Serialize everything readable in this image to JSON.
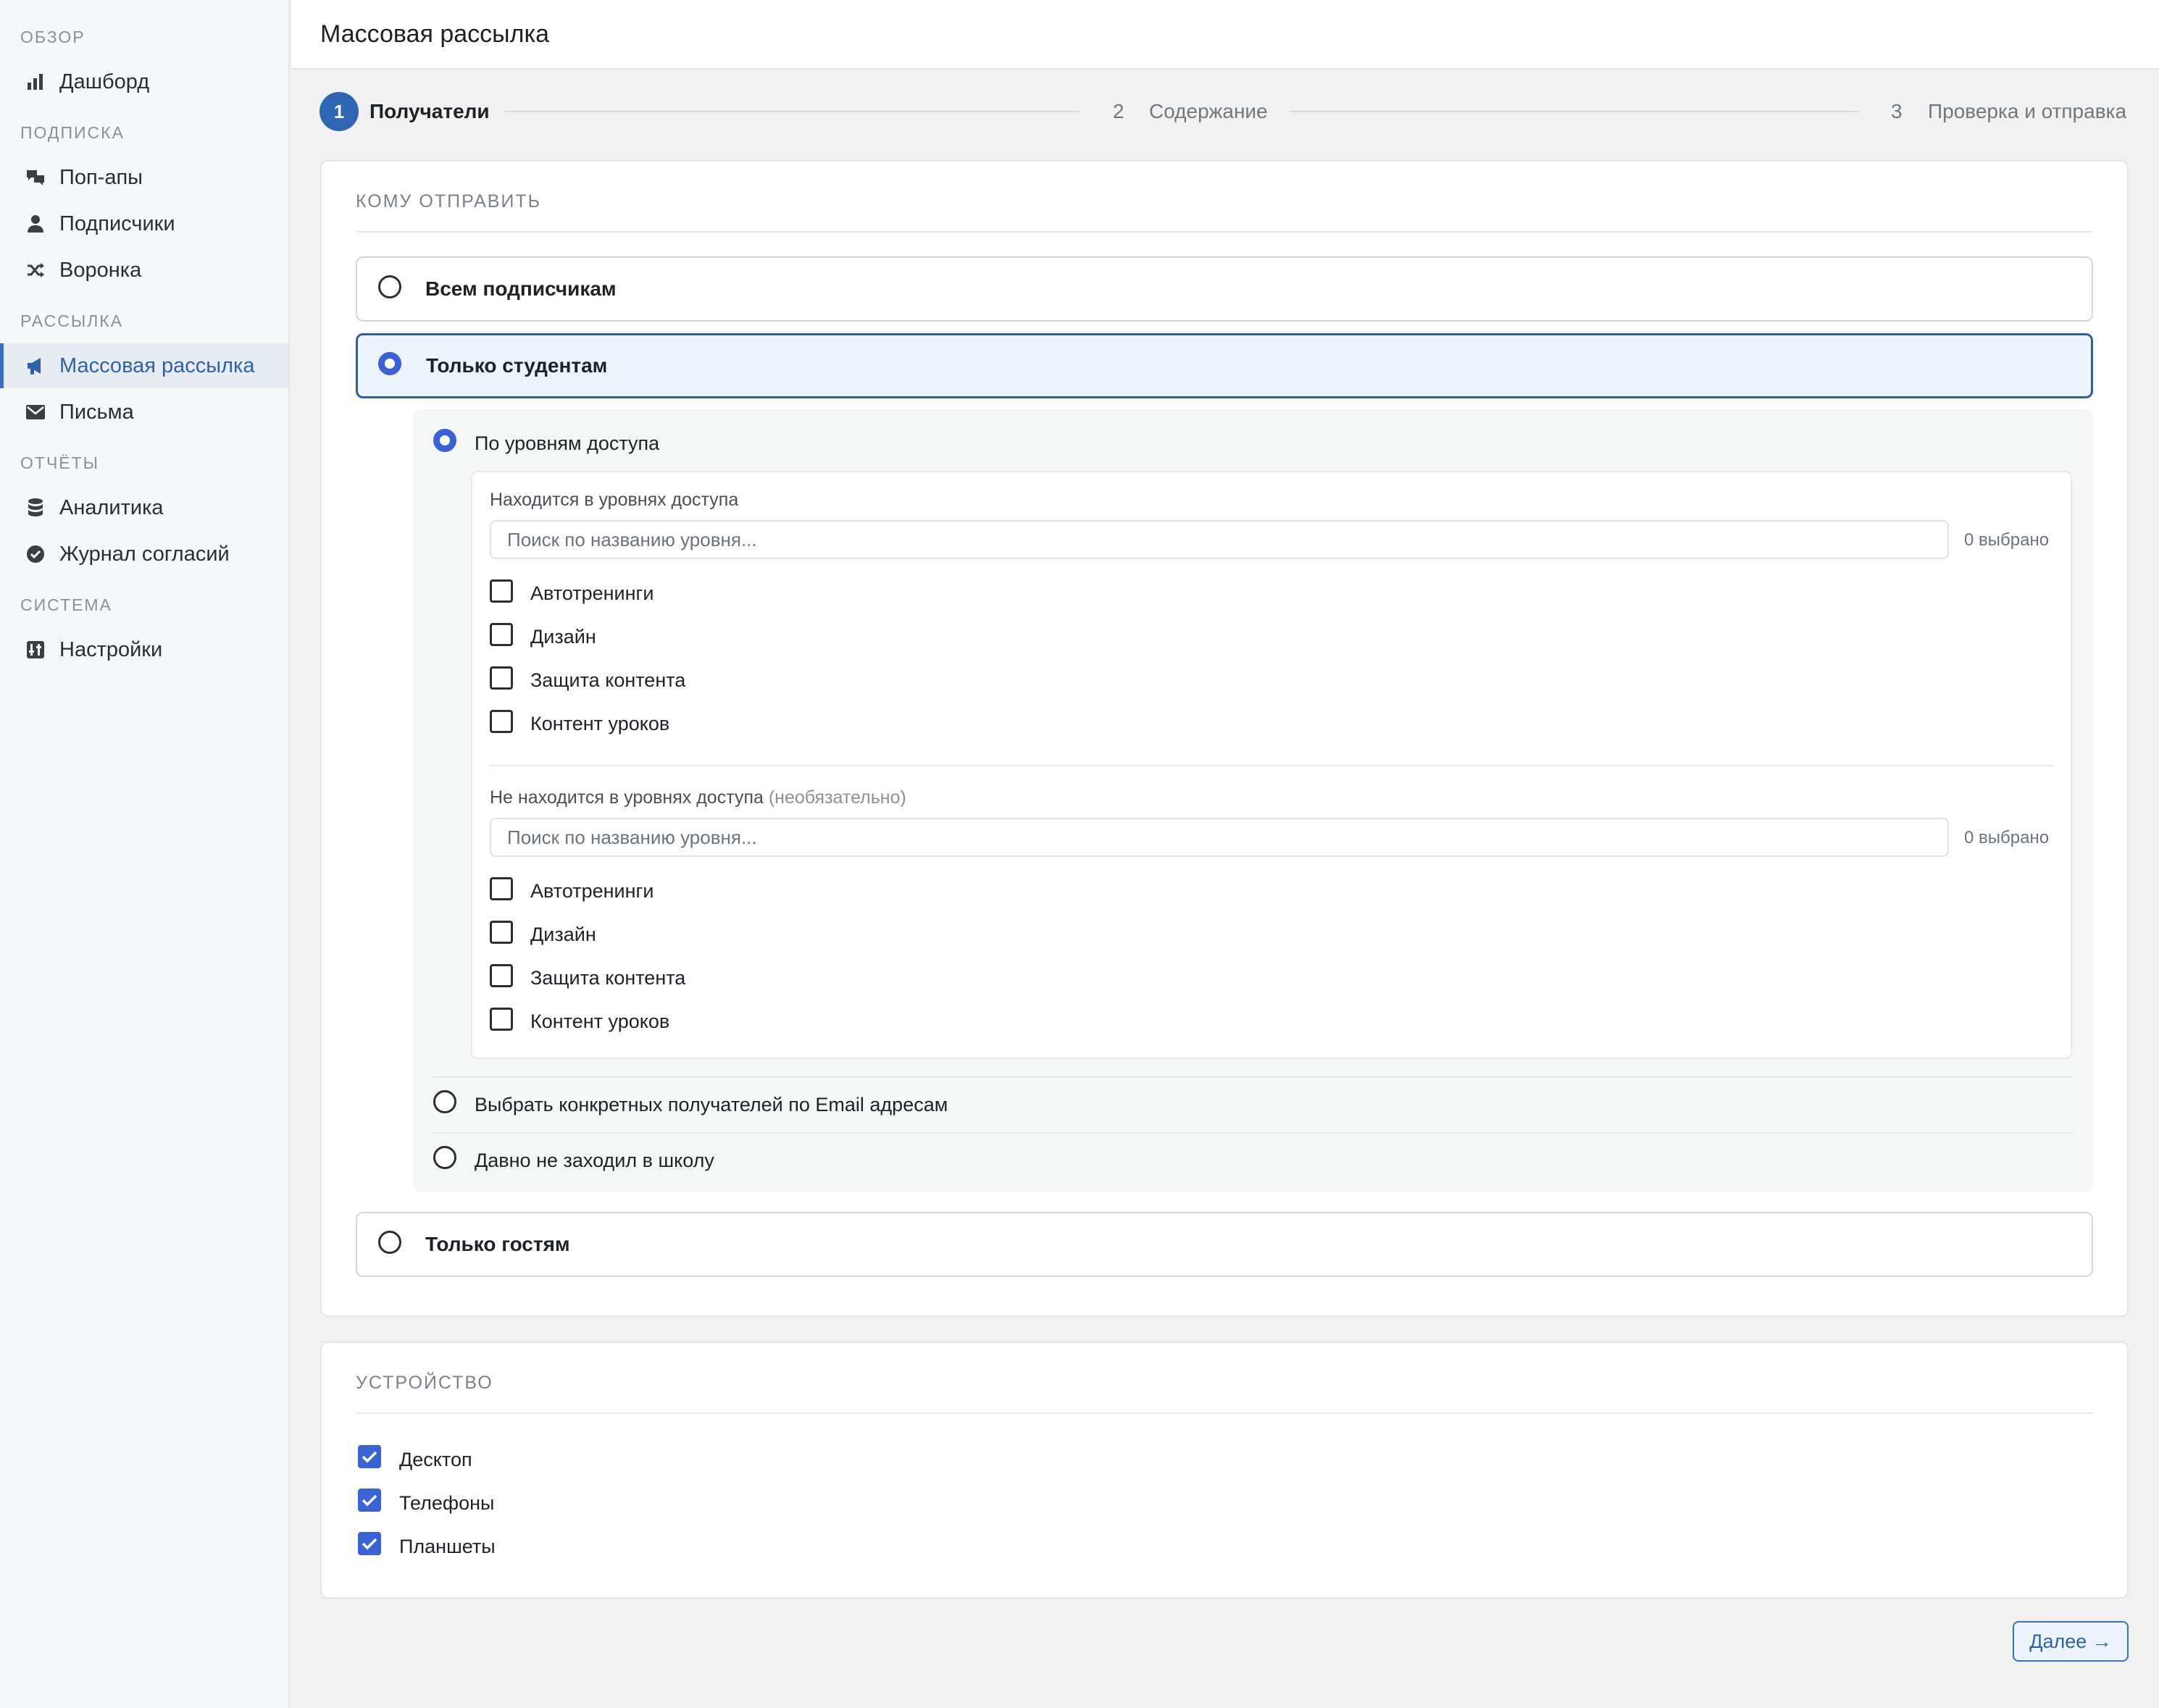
{
  "sidebar": {
    "sections": [
      {
        "title": "ОБЗОР",
        "items": [
          {
            "label": "Дашборд",
            "icon": "bar-chart-icon"
          }
        ]
      },
      {
        "title": "ПОДПИСКА",
        "items": [
          {
            "label": "Поп-апы",
            "icon": "chat-bubbles-icon"
          },
          {
            "label": "Подписчики",
            "icon": "user-icon"
          },
          {
            "label": "Воронка",
            "icon": "shuffle-icon"
          }
        ]
      },
      {
        "title": "РАССЫЛКА",
        "items": [
          {
            "label": "Массовая рассылка",
            "icon": "megaphone-icon",
            "active": true
          },
          {
            "label": "Письма",
            "icon": "envelope-icon"
          }
        ]
      },
      {
        "title": "ОТЧЁТЫ",
        "items": [
          {
            "label": "Аналитика",
            "icon": "database-icon"
          },
          {
            "label": "Журнал согласий",
            "icon": "check-circle-icon"
          }
        ]
      },
      {
        "title": "СИСТЕМА",
        "items": [
          {
            "label": "Настройки",
            "icon": "settings-icon"
          }
        ]
      }
    ]
  },
  "header": {
    "title": "Массовая рассылка"
  },
  "stepper": {
    "steps": [
      {
        "num": "1",
        "label": "Получатели",
        "active": true
      },
      {
        "num": "2",
        "label": "Содержание",
        "active": false
      },
      {
        "num": "3",
        "label": "Проверка и отправка",
        "active": false
      }
    ]
  },
  "recipients": {
    "title": "КОМУ ОТПРАВИТЬ",
    "options": {
      "all": "Всем подписчикам",
      "students": "Только студентам",
      "guests": "Только гостям"
    },
    "selected": "students",
    "student_modes": {
      "by_level": "По уровням доступа",
      "by_email": "Выбрать конкретных получателей по Email адресам",
      "inactive": "Давно не заходил в школу"
    },
    "include": {
      "label": "Находится в уровнях доступа",
      "placeholder": "Поиск по названию уровня...",
      "count": "0 выбрано",
      "levels": [
        "Автотренинги",
        "Дизайн",
        "Защита контента",
        "Контент уроков"
      ]
    },
    "exclude": {
      "label": "Не находится в уровнях доступа",
      "optional": "(необязательно)",
      "placeholder": "Поиск по названию уровня...",
      "count": "0 выбрано",
      "levels": [
        "Автотренинги",
        "Дизайн",
        "Защита контента",
        "Контент уроков"
      ]
    }
  },
  "device": {
    "title": "УСТРОЙСТВО",
    "items": [
      {
        "label": "Десктоп",
        "checked": true
      },
      {
        "label": "Телефоны",
        "checked": true
      },
      {
        "label": "Планшеты",
        "checked": true
      }
    ]
  },
  "footer": {
    "next_label": "Далее →"
  },
  "colors": {
    "accent": "#3a62d6",
    "active_nav": "#2d62a8",
    "step_circle": "#2f66b3"
  }
}
